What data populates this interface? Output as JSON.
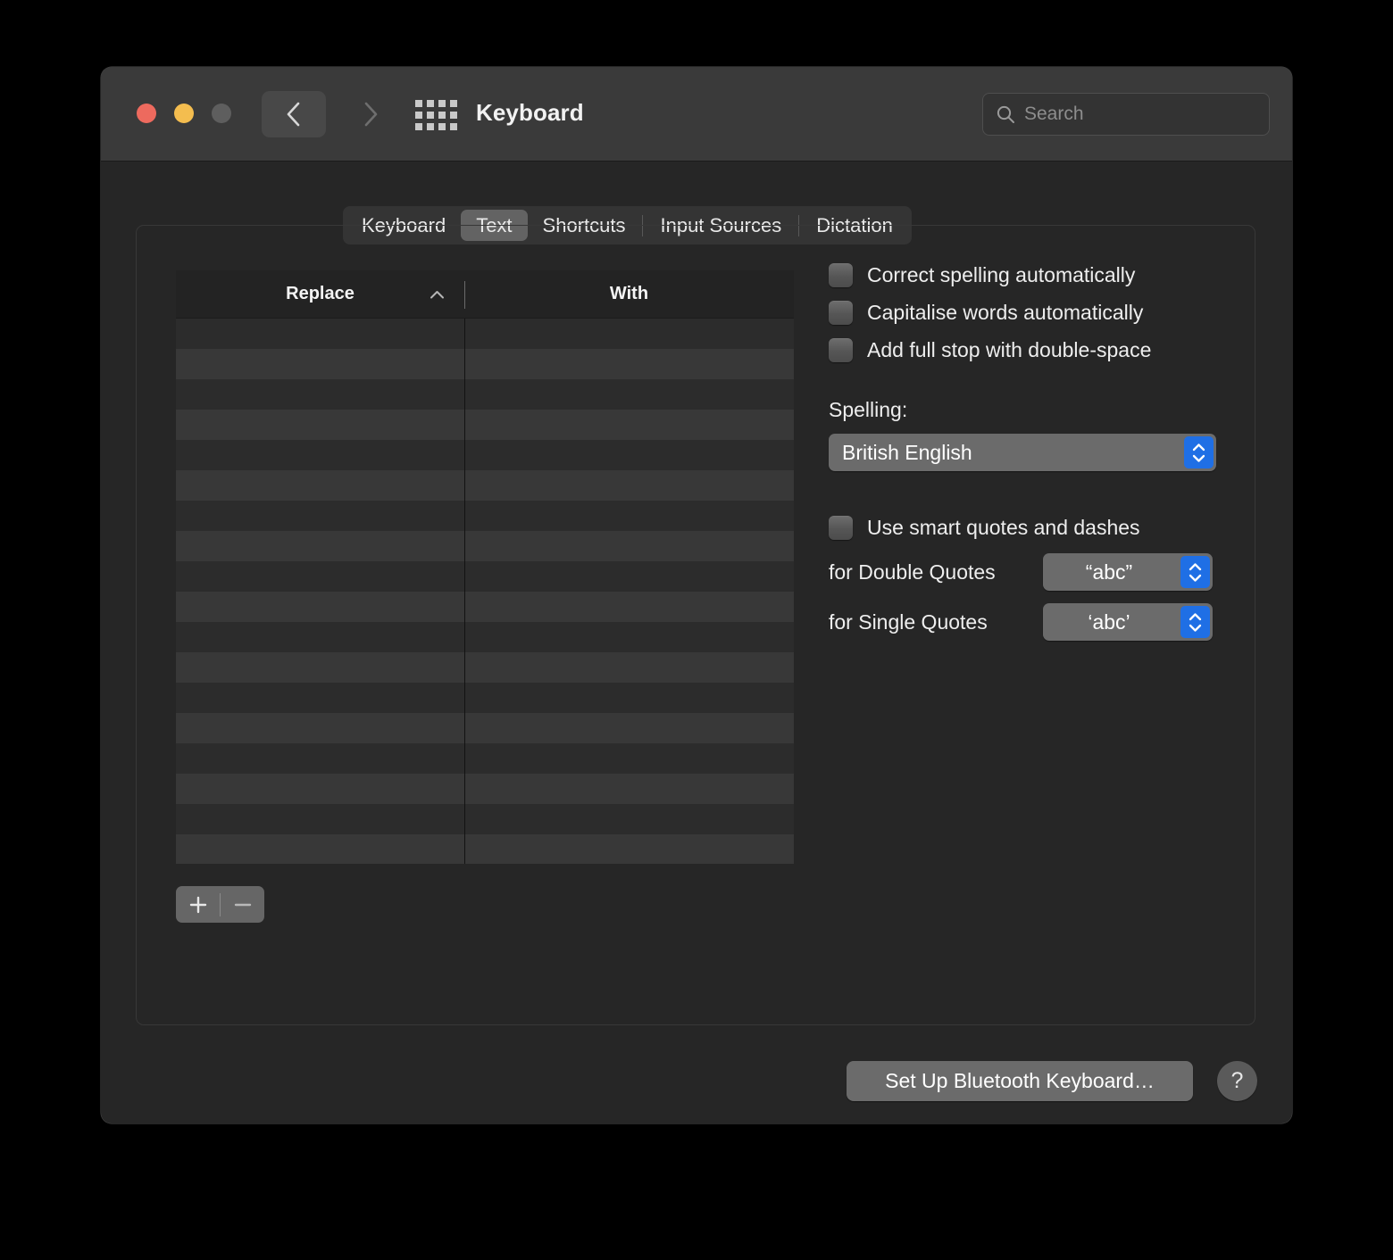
{
  "window": {
    "title": "Keyboard",
    "traffic_lights": [
      {
        "name": "close",
        "color": "#ed6a5e"
      },
      {
        "name": "minimize",
        "color": "#f4bd4f"
      },
      {
        "name": "zoom",
        "color": "#5e5e5e"
      }
    ],
    "nav": {
      "back_icon": "chevron-left-icon",
      "forward_icon": "chevron-right-icon"
    },
    "grid_icon": "show-all-grid-icon"
  },
  "search": {
    "placeholder": "Search",
    "value": "",
    "icon": "search-icon"
  },
  "tabs": [
    {
      "label": "Keyboard",
      "selected": false
    },
    {
      "label": "Text",
      "selected": true
    },
    {
      "label": "Shortcuts",
      "selected": false
    },
    {
      "label": "Input Sources",
      "selected": false
    },
    {
      "label": "Dictation",
      "selected": false
    }
  ],
  "table": {
    "columns": [
      {
        "label": "Replace",
        "sorted": "ascending",
        "sort_icon": "chevron-up-icon"
      },
      {
        "label": "With",
        "sorted": null
      }
    ],
    "rows": [],
    "empty_row_count": 18
  },
  "table_controls": {
    "add_label": "+",
    "remove_label": "—",
    "add_icon": "plus-icon",
    "remove_icon": "minus-icon"
  },
  "options": {
    "checkboxes": [
      {
        "label": "Correct spelling automatically",
        "checked": false
      },
      {
        "label": "Capitalise words automatically",
        "checked": false
      },
      {
        "label": "Add full stop with double-space",
        "checked": false
      }
    ],
    "spelling": {
      "label": "Spelling:",
      "value": "British English"
    },
    "smart_quotes": {
      "label": "Use smart quotes and dashes",
      "checked": false,
      "double": {
        "label": "for Double Quotes",
        "value": "“abc”"
      },
      "single": {
        "label": "for Single Quotes",
        "value": "‘abc’"
      }
    }
  },
  "footer": {
    "bluetooth_label": "Set Up Bluetooth Keyboard…",
    "help_label": "?"
  },
  "colors": {
    "accent": "#1f6fe5",
    "titlebar": "#3a3a3a",
    "content_bg": "#262626",
    "row_odd": "#2c2c2c",
    "row_even": "#383838"
  }
}
